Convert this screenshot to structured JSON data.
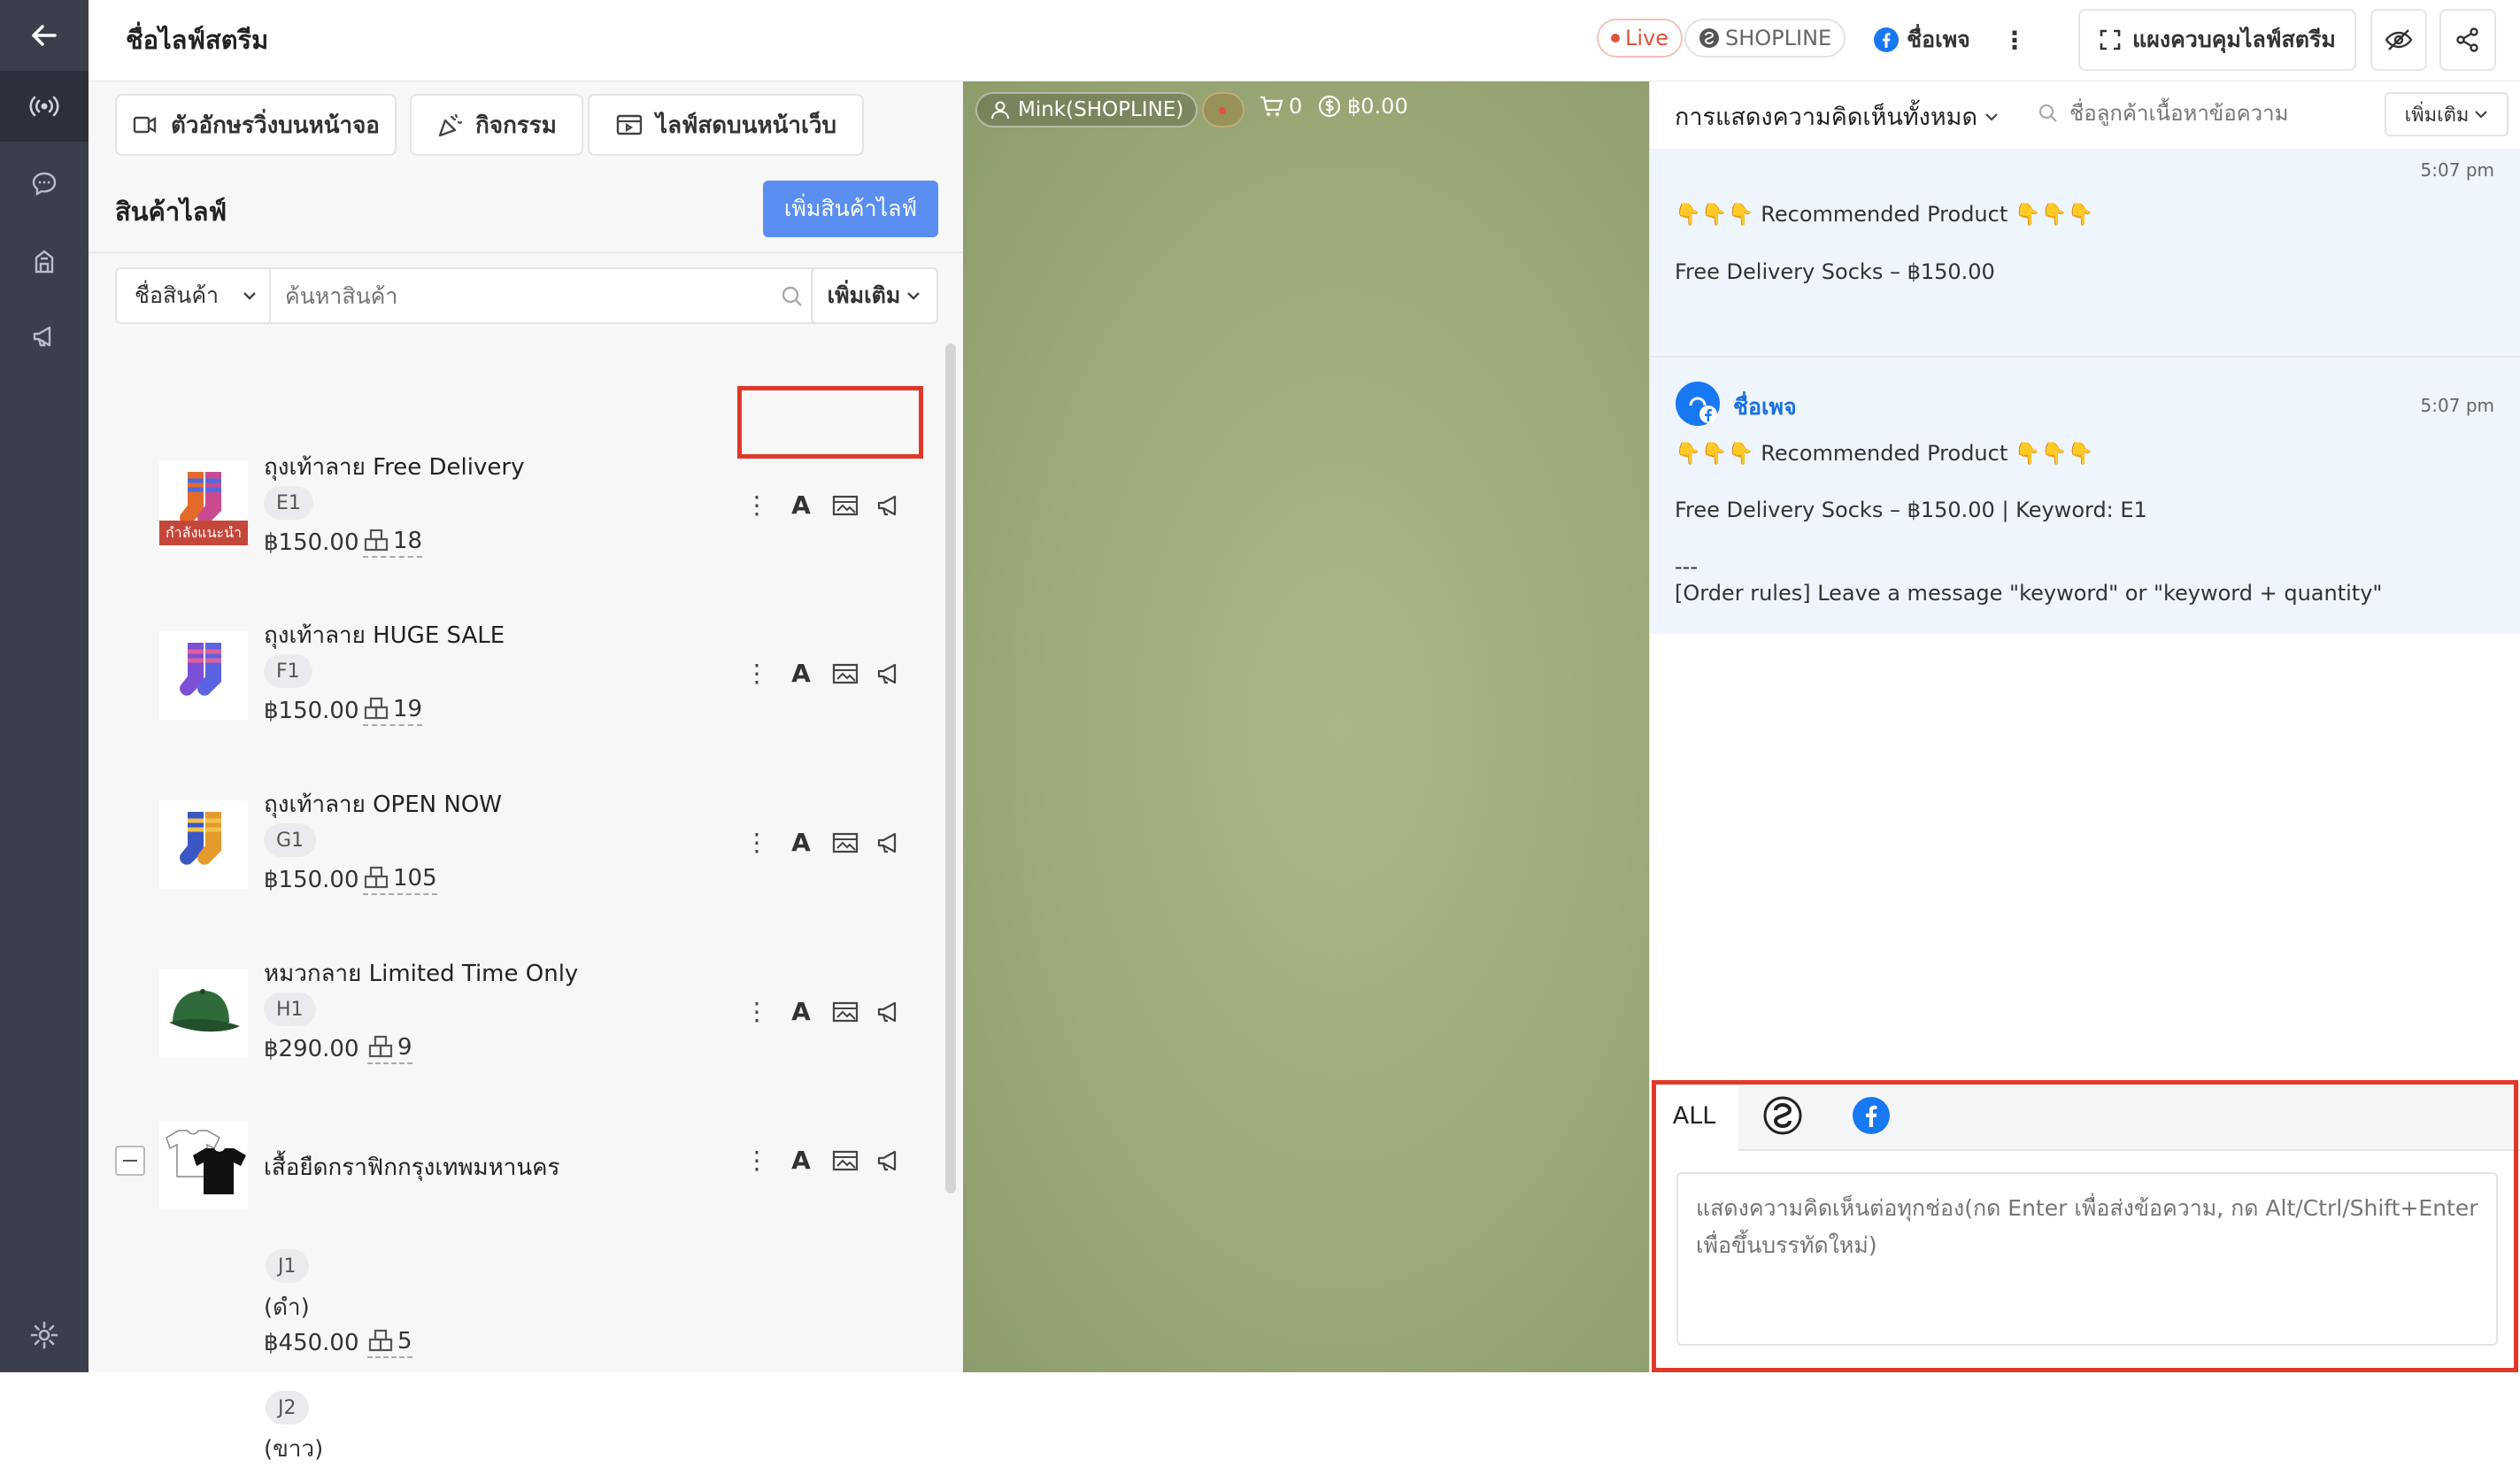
{
  "sidebar": {
    "items": [
      {
        "icon": "back-arrow-icon"
      },
      {
        "icon": "live-broadcast-icon"
      },
      {
        "icon": "chat-bubble-icon"
      },
      {
        "icon": "store-icon"
      },
      {
        "icon": "megaphone-icon"
      },
      {
        "icon": "settings-gear-icon"
      }
    ]
  },
  "header": {
    "title": "ชื่อไลฟ์สตรีม",
    "live_badge": "Live",
    "platform_badge": "SHOPLINE",
    "page_name": "ชื่อเพจ",
    "control_panel_label": "แผงควบคุมไลฟ์สตรีม"
  },
  "toolbar": {
    "marquee_label": "ตัวอักษรวิ่งบนหน้าจอ",
    "activity_label": "กิจกรรม",
    "web_live_label": "ไลฟ์สดบนหน้าเว็บ"
  },
  "products": {
    "section_title": "สินค้าไลฟ์",
    "add_button_label": "เพิ่มสินค้าไลฟ์",
    "filter_field": "ชื่อสินค้า",
    "search_placeholder": "ค้นหาสินค้า",
    "more_label": "เพิ่มเติม",
    "items": [
      {
        "name": "ถุงเท้าลาย Free Delivery",
        "keyword": "E1",
        "price": "฿150.00",
        "stock": "18",
        "badge": "กำลังแนะนำ"
      },
      {
        "name": "ถุงเท้าลาย HUGE SALE",
        "keyword": "F1",
        "price": "฿150.00",
        "stock": "19"
      },
      {
        "name": "ถุงเท้าลาย OPEN NOW",
        "keyword": "G1",
        "price": "฿150.00",
        "stock": "105"
      },
      {
        "name": "หมวกลาย Limited Time Only",
        "keyword": "H1",
        "price": "฿290.00",
        "stock": "9"
      },
      {
        "name": "เสื้อยืดกราฟิกกรุงเทพมหานคร",
        "variants": [
          {
            "keyword": "J1",
            "option": "(ดำ)",
            "price": "฿450.00",
            "stock": "5"
          },
          {
            "keyword": "J2",
            "option": "(ขาว)"
          }
        ]
      }
    ]
  },
  "video": {
    "host": "Mink(SHOPLINE)",
    "cart_count": "0",
    "sales_total": "฿0.00"
  },
  "comments": {
    "filter_label": "การแสดงความคิดเห็นทั้งหมด",
    "search_placeholder": "ชื่อลูกค้าเนื้อหาข้อความ",
    "more_label": "เพิ่มเติม",
    "messages": [
      {
        "time": "5:07 pm",
        "lines": [
          "👇👇👇 Recommended Product 👇👇👇",
          "Free Delivery Socks – ฿150.00"
        ]
      },
      {
        "author": "ชื่อเพจ",
        "time": "5:07 pm",
        "lines": [
          "👇👇👇 Recommended Product 👇👇👇",
          "Free Delivery Socks – ฿150.00 | Keyword: E1",
          "---",
          "[Order rules] Leave a message \"keyword\" or \"keyword + quantity\""
        ]
      }
    ],
    "tabs": [
      {
        "label": "ALL",
        "icon": ""
      },
      {
        "label": "",
        "icon": "shopline-icon"
      },
      {
        "label": "",
        "icon": "facebook-icon"
      }
    ],
    "input_placeholder": "แสดงความคิดเห็นต่อทุกช่อง(กด Enter เพื่อส่งข้อความ, กด Alt/Ctrl/Shift+Enter เพื่อขึ้นบรรทัดใหม่)"
  },
  "colors": {
    "sidebar_bg": "#3b3f4c",
    "primary": "#5a8ef0",
    "facebook": "#1877f2",
    "highlight": "#e0392b",
    "live_red": "#e0533d"
  }
}
